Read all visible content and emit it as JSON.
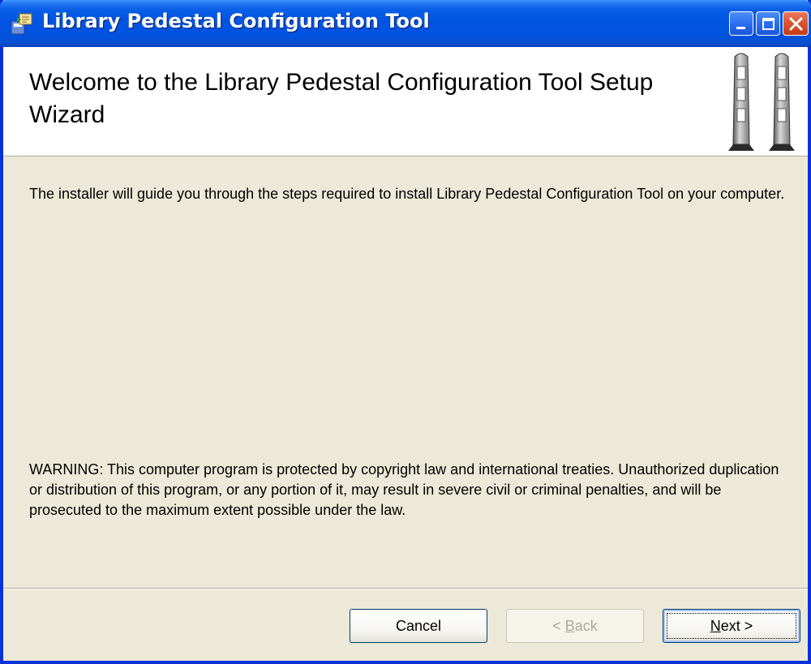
{
  "window": {
    "title": "Library Pedestal Configuration Tool"
  },
  "header": {
    "title": "Welcome to the Library Pedestal Configuration Tool Setup Wizard"
  },
  "body": {
    "intro": "The installer will guide you through the steps required to install Library Pedestal Configuration Tool on your computer.",
    "warning": "WARNING: This computer program is protected by copyright law and international treaties. Unauthorized duplication or distribution of this program, or any portion of it, may result in severe civil or criminal penalties, and will be prosecuted to the maximum extent possible under the law."
  },
  "buttons": {
    "cancel": "Cancel",
    "back_prefix": "< ",
    "back_access": "B",
    "back_rest": "ack",
    "next_access": "N",
    "next_rest": "ext >"
  },
  "icons": {
    "app": "installer-icon",
    "minimize": "minimize-icon",
    "maximize": "maximize-icon",
    "close": "close-icon",
    "header_art": "security-pedestal-gates"
  },
  "colors": {
    "titlebar": "#0054e3",
    "face": "#ece9d8",
    "close": "#d9542f"
  }
}
